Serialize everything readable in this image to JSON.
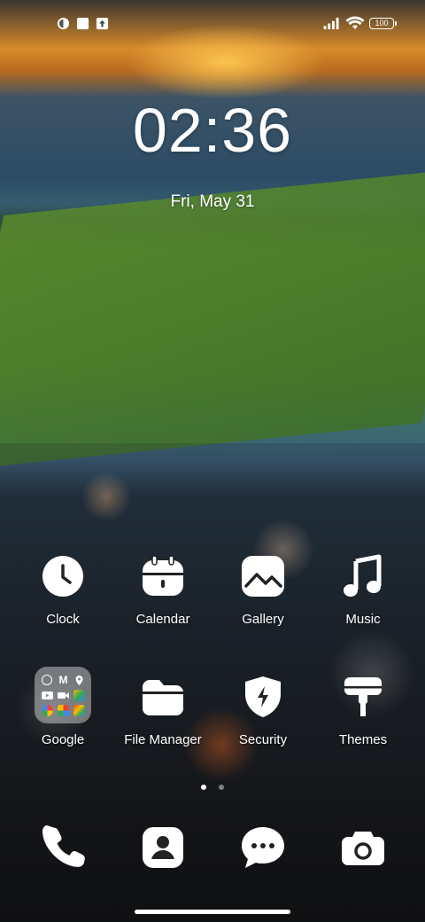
{
  "status_bar": {
    "left_icons": [
      "privacy-dot-icon",
      "notification-square-icon",
      "upload-box-icon"
    ],
    "right_icons": [
      "signal-icon",
      "wifi-icon",
      "battery-icon"
    ],
    "battery_level": "100"
  },
  "lockclock": {
    "time": "02:36",
    "date": "Fri, May 31"
  },
  "apps_row1": [
    {
      "label": "Clock",
      "icon": "clock-icon"
    },
    {
      "label": "Calendar",
      "icon": "calendar-icon"
    },
    {
      "label": "Gallery",
      "icon": "gallery-icon"
    },
    {
      "label": "Music",
      "icon": "music-note-icon"
    }
  ],
  "apps_row2": [
    {
      "label": "Google",
      "icon": "google-folder-icon"
    },
    {
      "label": "File Manager",
      "icon": "folder-icon"
    },
    {
      "label": "Security",
      "icon": "security-shield-icon"
    },
    {
      "label": "Themes",
      "icon": "paint-roller-icon"
    }
  ],
  "page_indicator": {
    "pages": 2,
    "current": 1
  },
  "dock": [
    {
      "icon": "phone-icon"
    },
    {
      "icon": "contacts-icon"
    },
    {
      "icon": "messages-icon"
    },
    {
      "icon": "camera-icon"
    }
  ],
  "colors": {
    "accent": "#ffffff",
    "sunset": "#f0a030"
  }
}
